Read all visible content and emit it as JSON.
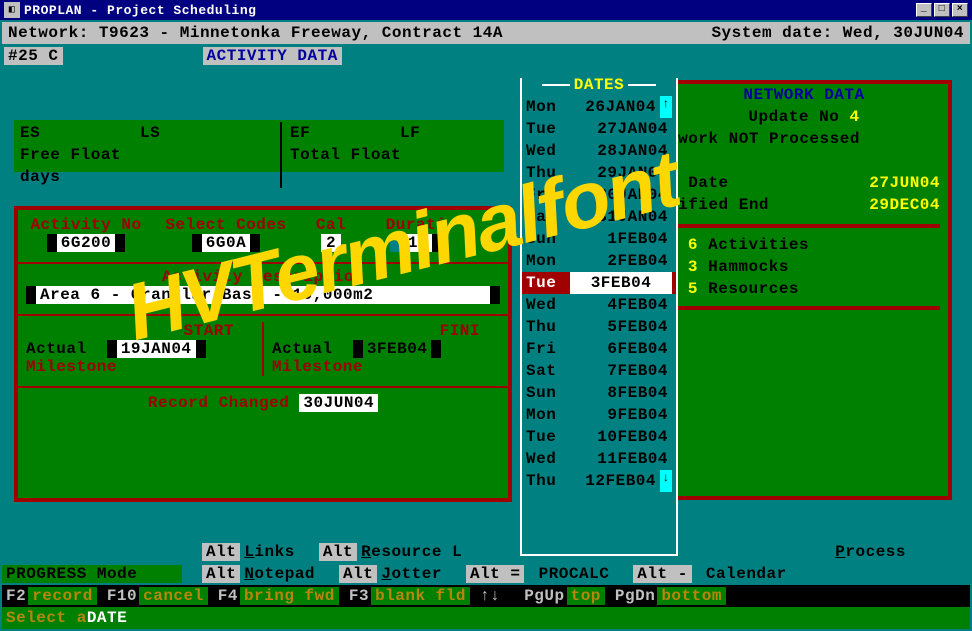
{
  "window": {
    "title": "PROPLAN  -  Project Scheduling",
    "min": "_",
    "max": "□",
    "close": "×"
  },
  "header": {
    "network_label": "Network:",
    "network_value": "T9623 - Minnetonka Freeway, Contract 14A",
    "sysdate_label": "System date:",
    "sysdate_value": "Wed, 30JUN04"
  },
  "activity_bar": {
    "record": "#25   C",
    "title": "ACTIVITY DATA"
  },
  "floats": {
    "es": "ES",
    "ls": "LS",
    "ef": "EF",
    "lf": "LF",
    "free": "Free Float",
    "days": "days",
    "total": "Total Float"
  },
  "fields": {
    "act_no_label": "Activity No",
    "act_no": "6G200",
    "sel_label": "Select Codes",
    "sel": "6G0A",
    "cal_label": "Cal",
    "cal": "2",
    "dur_label": "Durati",
    "dur": "15",
    "desc_label": "Activity Description",
    "desc": "Area 6 - Granular Base - 10,000m2",
    "start_label": "START",
    "finish_label": "FINI",
    "actual": "Actual",
    "milestone": "Milestone",
    "start_val": "19JAN04",
    "finish_val": "3FEB04",
    "rec_changed_label": "Record Changed",
    "rec_changed": "30JUN04"
  },
  "dates": {
    "title": "DATES",
    "rows": [
      {
        "dow": "Mon",
        "dt": "26JAN04"
      },
      {
        "dow": "Tue",
        "dt": "27JAN04"
      },
      {
        "dow": "Wed",
        "dt": "28JAN04"
      },
      {
        "dow": "Thu",
        "dt": "29JAN04"
      },
      {
        "dow": "Fri",
        "dt": "30JAN04"
      },
      {
        "dow": "Sat",
        "dt": "31JAN04"
      },
      {
        "dow": "Sun",
        "dt": "1FEB04"
      },
      {
        "dow": "Mon",
        "dt": "2FEB04"
      },
      {
        "dow": "Tue",
        "dt": "3FEB04"
      },
      {
        "dow": "Wed",
        "dt": "4FEB04"
      },
      {
        "dow": "Thu",
        "dt": "5FEB04"
      },
      {
        "dow": "Fri",
        "dt": "6FEB04"
      },
      {
        "dow": "Sat",
        "dt": "7FEB04"
      },
      {
        "dow": "Sun",
        "dt": "8FEB04"
      },
      {
        "dow": "Mon",
        "dt": "9FEB04"
      },
      {
        "dow": "Tue",
        "dt": "10FEB04"
      },
      {
        "dow": "Wed",
        "dt": "11FEB04"
      },
      {
        "dow": "Thu",
        "dt": "12FEB04"
      }
    ],
    "selected_index": 8
  },
  "network_data": {
    "title": "NETWORK DATA",
    "update_label": "Update No",
    "update_no": "4",
    "proc": "twork NOT Processed",
    "a_date_label": "a Date",
    "a_date": "27JUN04",
    "end_label": "cified End",
    "end_date": "29DEC04",
    "acts_n": "6",
    "acts_label": "Activities",
    "ham_n": "3",
    "ham_label": "Hammocks",
    "res_n": "5",
    "res_label": "Resources"
  },
  "bottom": {
    "alt1": [
      {
        "cls": "gry",
        "txt": "Alt",
        "u": "L"
      },
      {
        "cls": "teal",
        "txt": "inks"
      },
      {
        "cls": "gry",
        "txt": "Alt",
        "u": "R"
      },
      {
        "cls": "teal",
        "txt": "esource L"
      },
      {
        "cls": "teal",
        "txt": "Process",
        "u": "P"
      }
    ],
    "progress": "PROGRESS Mode",
    "alt2": [
      {
        "cls": "gry",
        "txt": "Alt",
        "u": "N"
      },
      {
        "cls": "teal",
        "txt": "otepad"
      },
      {
        "cls": "gry",
        "txt": "Alt",
        "u": "J"
      },
      {
        "cls": "teal",
        "txt": "otter"
      },
      {
        "cls": "gry",
        "txt": "Alt ="
      },
      {
        "cls": "teal",
        "txt": "PROCALC"
      },
      {
        "cls": "gry",
        "txt": "Alt -"
      },
      {
        "cls": "teal",
        "txt": "Calendar"
      }
    ],
    "keys": [
      {
        "k": "F2",
        "a": "record"
      },
      {
        "k": "F10",
        "a": "cancel"
      },
      {
        "k": "F4",
        "a": "bring fwd"
      },
      {
        "k": "F3",
        "a": "blank fld"
      },
      {
        "k": "↑↓",
        "a": ""
      },
      {
        "k": "PgUp",
        "a": "top"
      },
      {
        "k": "PgDn",
        "a": "bottom"
      }
    ],
    "status_prefix": "Select a ",
    "status_field": "DATE"
  },
  "watermark": "HVTerminalfont"
}
